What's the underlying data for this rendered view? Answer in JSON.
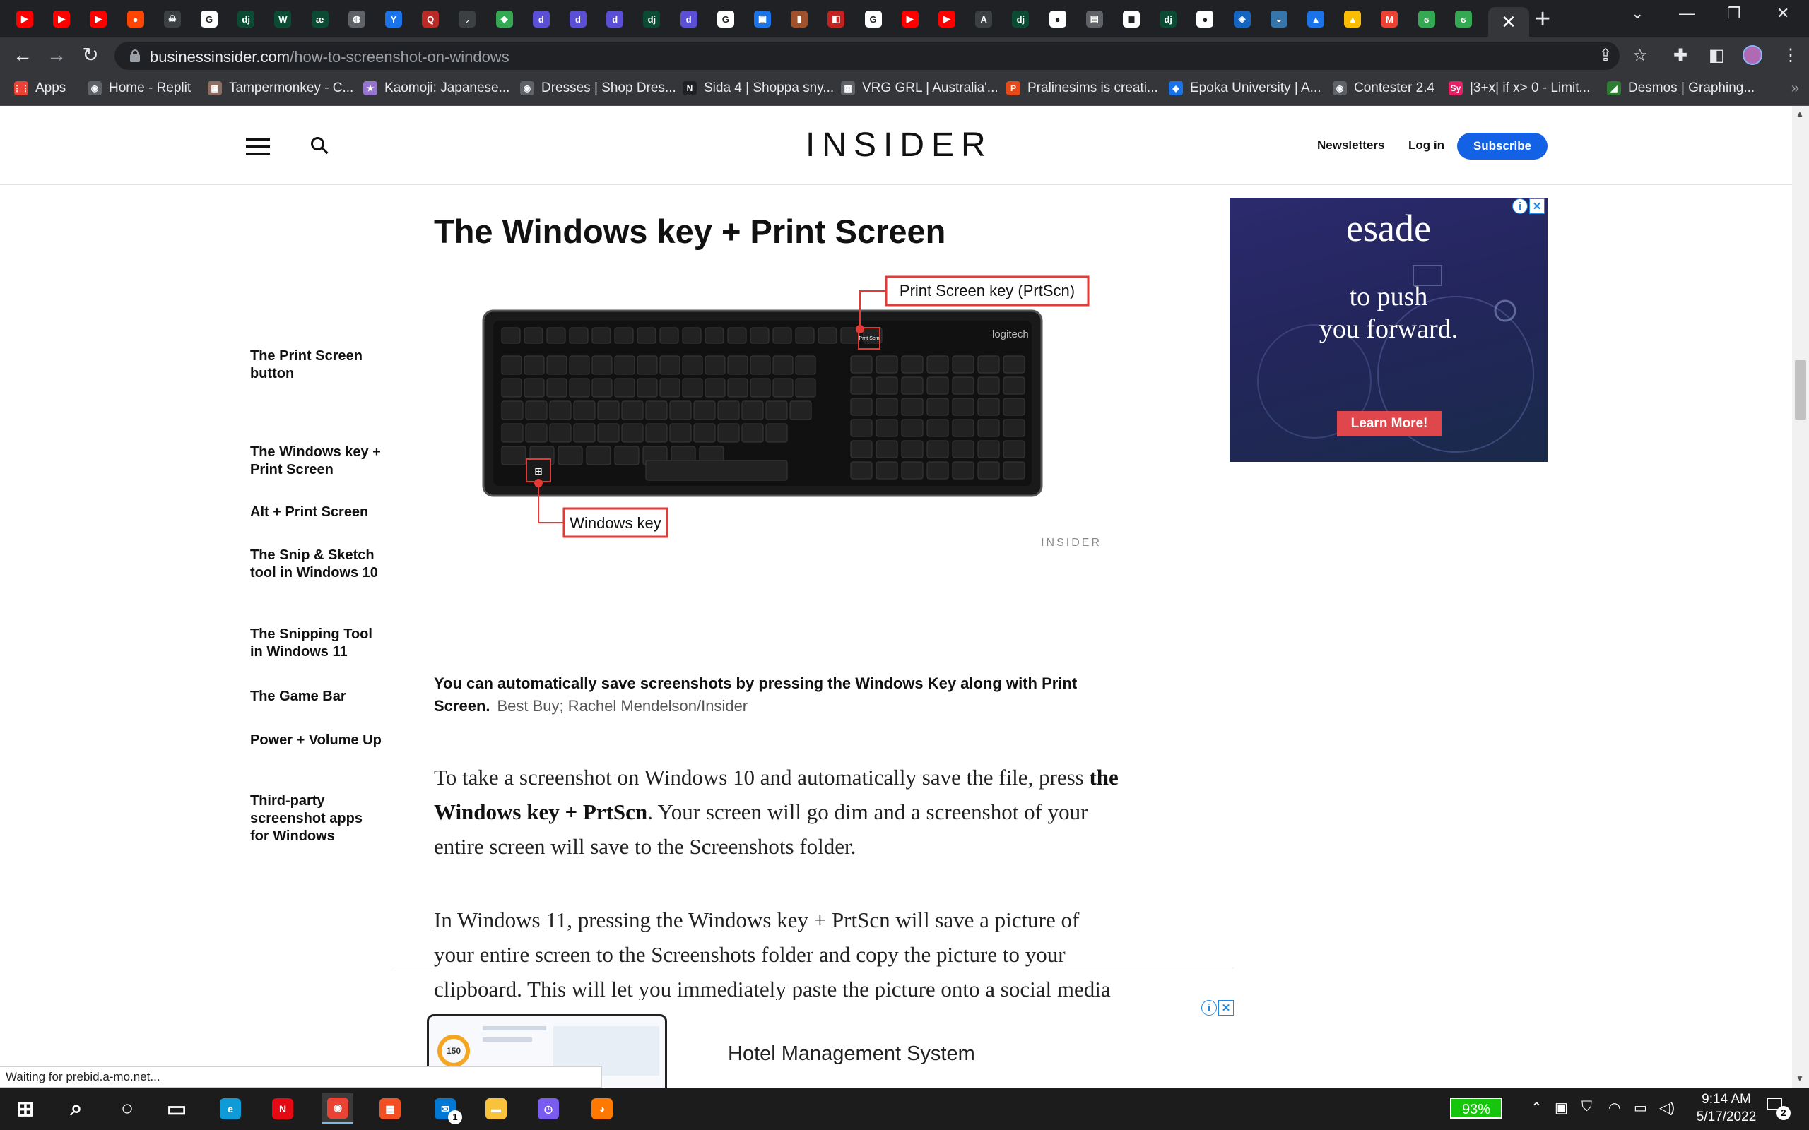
{
  "browser": {
    "tab_favicons": [
      {
        "name": "youtube",
        "color": "#ff0000",
        "glyph": "▶"
      },
      {
        "name": "youtube",
        "color": "#ff0000",
        "glyph": "▶"
      },
      {
        "name": "youtube",
        "color": "#ff0000",
        "glyph": "▶"
      },
      {
        "name": "reddit",
        "color": "#ff4500",
        "glyph": "●"
      },
      {
        "name": "pirate",
        "color": "#3c4043",
        "glyph": "☠"
      },
      {
        "name": "google",
        "color": "#ffffff",
        "glyph": "G"
      },
      {
        "name": "django",
        "color": "#0c4b33",
        "glyph": "dj"
      },
      {
        "name": "webflow",
        "color": "#0c4b33",
        "glyph": "W"
      },
      {
        "name": "wordle",
        "color": "#0c4b33",
        "glyph": "æ"
      },
      {
        "name": "globe",
        "color": "#5f6368",
        "glyph": "◍"
      },
      {
        "name": "y-app",
        "color": "#1a73e8",
        "glyph": "Y"
      },
      {
        "name": "quora",
        "color": "#b92b27",
        "glyph": "Q"
      },
      {
        "name": "tool",
        "color": "#3c4043",
        "glyph": "⸝"
      },
      {
        "name": "leaf",
        "color": "#34a853",
        "glyph": "◆"
      },
      {
        "name": "d-app",
        "color": "#5b4fd6",
        "glyph": "d"
      },
      {
        "name": "d-app",
        "color": "#5b4fd6",
        "glyph": "d"
      },
      {
        "name": "d-app",
        "color": "#5b4fd6",
        "glyph": "d"
      },
      {
        "name": "django",
        "color": "#0c4b33",
        "glyph": "dj"
      },
      {
        "name": "d-app",
        "color": "#5b4fd6",
        "glyph": "d"
      },
      {
        "name": "google",
        "color": "#ffffff",
        "glyph": "G"
      },
      {
        "name": "calendar",
        "color": "#1a73e8",
        "glyph": "▣"
      },
      {
        "name": "book",
        "color": "#a0522d",
        "glyph": "▮"
      },
      {
        "name": "tool",
        "color": "#c5221f",
        "glyph": "◧"
      },
      {
        "name": "google",
        "color": "#ffffff",
        "glyph": "G"
      },
      {
        "name": "youtube",
        "color": "#ff0000",
        "glyph": "▶"
      },
      {
        "name": "youtube",
        "color": "#ff0000",
        "glyph": "▶"
      },
      {
        "name": "a-app",
        "color": "#3c4043",
        "glyph": "A"
      },
      {
        "name": "django",
        "color": "#0c4b33",
        "glyph": "dj"
      },
      {
        "name": "github",
        "color": "#ffffff",
        "glyph": "●"
      },
      {
        "name": "doc",
        "color": "#5f6368",
        "glyph": "▤"
      },
      {
        "name": "notion",
        "color": "#ffffff",
        "glyph": "◼"
      },
      {
        "name": "django",
        "color": "#0c4b33",
        "glyph": "dj"
      },
      {
        "name": "github",
        "color": "#ffffff",
        "glyph": "●"
      },
      {
        "name": "fox",
        "color": "#1565c0",
        "glyph": "◈"
      },
      {
        "name": "python",
        "color": "#3776ab",
        "glyph": "◒"
      },
      {
        "name": "photos",
        "color": "#1a73e8",
        "glyph": "▲"
      },
      {
        "name": "drive",
        "color": "#fbbc04",
        "glyph": "▲"
      },
      {
        "name": "gmail",
        "color": "#ea4335",
        "glyph": "M"
      },
      {
        "name": "loop",
        "color": "#34a853",
        "glyph": "ϭ"
      },
      {
        "name": "loop",
        "color": "#34a853",
        "glyph": "ϭ"
      }
    ],
    "active_tab_close": "✕",
    "new_tab": "+",
    "window_controls": [
      "⌄",
      "—",
      "❐",
      "✕"
    ],
    "url_host": "businessinsider.com",
    "url_path": "/how-to-screenshot-on-windows",
    "toolbar_icons": [
      "share-icon",
      "star-icon",
      "extensions-icon",
      "sidepanel-icon",
      "profile-avatar",
      "menu-icon"
    ],
    "bookmarks": [
      {
        "label": "Apps",
        "color": "#ea4335",
        "glyph": "⋮⋮"
      },
      {
        "label": "Home - Replit",
        "color": "#5f6368",
        "glyph": "◉"
      },
      {
        "label": "Tampermonkey - C...",
        "color": "#8d6e63",
        "glyph": "▦"
      },
      {
        "label": "Kaomoji: Japanese...",
        "color": "#9575cd",
        "glyph": "★"
      },
      {
        "label": "Dresses | Shop Dres...",
        "color": "#5f6368",
        "glyph": "◉"
      },
      {
        "label": "Sida 4 | Shoppa sny...",
        "color": "#202124",
        "glyph": "N"
      },
      {
        "label": "VRG GRL | Australia'...",
        "color": "#5f6368",
        "glyph": "▩"
      },
      {
        "label": "Pralinesims is creati...",
        "color": "#e64a19",
        "glyph": "P"
      },
      {
        "label": "Epoka University | A...",
        "color": "#1a73e8",
        "glyph": "◆"
      },
      {
        "label": "Contester 2.4",
        "color": "#5f6368",
        "glyph": "◉"
      },
      {
        "label": "|3+x| if x> 0 - Limit...",
        "color": "#e91e63",
        "glyph": "Sy"
      },
      {
        "label": "Desmos | Graphing...",
        "color": "#2e7d32",
        "glyph": "◢"
      }
    ]
  },
  "site": {
    "logo": "INSIDER",
    "newsletters": "Newsletters",
    "login": "Log in",
    "subscribe": "Subscribe"
  },
  "toc": [
    "The Print Screen button",
    "The Windows key + Print Screen",
    "Alt + Print Screen",
    "The Snip & Sketch tool in Windows 10",
    "The Snipping Tool in Windows 11",
    "The Game Bar",
    "Power + Volume Up",
    "Third-party screenshot apps for Windows"
  ],
  "article": {
    "heading": "The Windows key + Print Screen",
    "figure": {
      "keyboard_brand": "logitech",
      "callout_prtscn": "Print Screen key (PrtScn)",
      "callout_win": "Windows key",
      "prtscn_keycap": "Prnt Scrn",
      "watermark": "INSIDER"
    },
    "caption": "You can automatically save screenshots by pressing the Windows Key along with Print Screen.",
    "caption_source": "Best Buy; Rachel Mendelson/Insider",
    "para1_a": "To take a screenshot on Windows 10 and automatically save the file, press ",
    "para1_b": "the Windows key + PrtScn",
    "para1_c": ". Your screen will go dim and a screenshot of your entire screen will save to the Screenshots folder.",
    "para2": "In Windows 11, pressing the Windows key + PrtScn will save a picture of your entire screen to the Screenshots folder and copy the picture to your clipboard. This will let you immediately paste the picture onto a social media post, art app, and more."
  },
  "side_ad": {
    "brand": "esade",
    "line1": "to push",
    "line2": "you forward.",
    "cta": "Learn More!",
    "info": "i",
    "close": "✕"
  },
  "bottom_ad": {
    "title": "Hotel Management System",
    "gauge_value": "150",
    "info": "i",
    "close": "✕"
  },
  "status_text": "Waiting for prebid.a-mo.net...",
  "taskbar": {
    "apps": [
      {
        "name": "windows-start",
        "color": "#ffffff",
        "glyph": "⊞"
      },
      {
        "name": "search",
        "color": "#ffffff",
        "glyph": "⌕"
      },
      {
        "name": "cortana",
        "color": "#ffffff",
        "glyph": "○"
      },
      {
        "name": "task-view",
        "color": "#ffffff",
        "glyph": "▭"
      },
      {
        "name": "edge",
        "color": "#0f9bd7",
        "glyph": "e"
      },
      {
        "name": "netflix",
        "color": "#e50914",
        "glyph": "N"
      },
      {
        "name": "chrome",
        "color": "#ea4335",
        "glyph": "◉"
      },
      {
        "name": "store",
        "color": "#f25022",
        "glyph": "▦"
      },
      {
        "name": "mail",
        "color": "#0078d4",
        "glyph": "✉"
      },
      {
        "name": "explorer",
        "color": "#f8c33a",
        "glyph": "▬"
      },
      {
        "name": "clock-app",
        "color": "#7b5cf0",
        "glyph": "◷"
      },
      {
        "name": "avast",
        "color": "#ff7800",
        "glyph": "◕"
      }
    ],
    "mail_badge": "1",
    "battery": "93%",
    "time": "9:14 AM",
    "date": "5/17/2022",
    "notifications": "2"
  }
}
